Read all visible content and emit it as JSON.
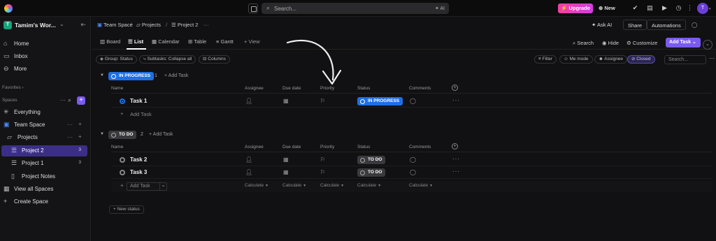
{
  "topbar": {
    "search_placeholder": "Search...",
    "search_ai": "AI",
    "upgrade": "Upgrade",
    "new": "New",
    "avatar": "T"
  },
  "sidebar": {
    "workspace_badge": "T",
    "workspace_name": "Tamim's Wor...",
    "nav": [
      {
        "label": "Home",
        "icon": "home-icon"
      },
      {
        "label": "Inbox",
        "icon": "inbox-icon"
      },
      {
        "label": "More",
        "icon": "more-icon"
      }
    ],
    "favorites": "Favorites",
    "spaces": "Spaces",
    "everything": "Everything",
    "team_space": "Team Space",
    "projects": "Projects",
    "project2": "Project 2",
    "project2_count": "3",
    "project1": "Project 1",
    "project1_count": "3",
    "project_notes": "Project Notes",
    "view_all": "View all Spaces",
    "create_space": "Create Space"
  },
  "breadcrumb": {
    "team_space": "Team Space",
    "projects": "Projects",
    "project2": "Project 2"
  },
  "header_actions": {
    "ask_ai": "Ask AI",
    "share": "Share",
    "automations": "Automations"
  },
  "views": {
    "tabs": [
      "Board",
      "List",
      "Calendar",
      "Table",
      "Gantt"
    ],
    "add_view": "View",
    "search": "Search",
    "hide": "Hide",
    "customize": "Customize",
    "add_task": "Add Task"
  },
  "filters": {
    "group": "Group: Status",
    "subtasks": "Subtasks: Collapse all",
    "columns": "Columns",
    "filter": "Filter",
    "me_mode": "Me mode",
    "assignee": "Assignee",
    "closed": "Closed",
    "search_placeholder": "Search..."
  },
  "columns": [
    "Name",
    "Assignee",
    "Due date",
    "Priority",
    "Status",
    "Comments"
  ],
  "groups": [
    {
      "status": "IN PROGRESS",
      "count": "1",
      "add_task": "Add Task",
      "tasks": [
        {
          "name": "Task 1",
          "status": "IN PROGRESS"
        }
      ],
      "add_row": "Add Task"
    },
    {
      "status": "TO DO",
      "count": "2",
      "add_task": "Add Task",
      "tasks": [
        {
          "name": "Task 2",
          "status": "TO DO"
        },
        {
          "name": "Task 3",
          "status": "TO DO"
        }
      ],
      "add_row": "Add Task",
      "calculate": "Calculate"
    }
  ],
  "new_status": "New status",
  "colors": {
    "accent": "#7b5af0",
    "in_progress": "#1e6fe6",
    "upgrade": "#f33fa0",
    "workspace": "#13a67a"
  }
}
